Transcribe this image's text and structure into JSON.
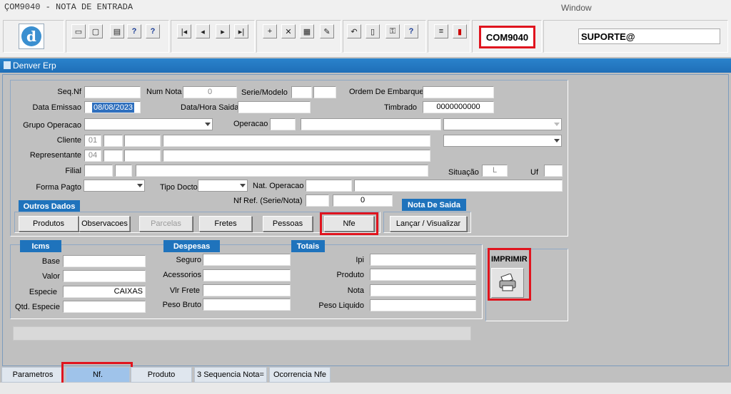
{
  "titlebar": {
    "title": "ÇOM9040 - NOTA DE ENTRADA",
    "menu": "Window"
  },
  "toolbar": {
    "form_code": "COM9040",
    "user": "SUPORTE@",
    "logo_letter": "d",
    "buttons": [
      {
        "name": "save-icon",
        "glyph": "▭"
      },
      {
        "name": "window-icon",
        "glyph": "▢"
      },
      {
        "name": "print-icon",
        "glyph": "▤"
      },
      {
        "name": "query-icon",
        "glyph": "?"
      },
      {
        "name": "execute-query-icon",
        "glyph": "?"
      },
      {
        "name": "first-record-icon",
        "glyph": "|◂"
      },
      {
        "name": "previous-record-icon",
        "glyph": "◂"
      },
      {
        "name": "next-record-icon",
        "glyph": "▸"
      },
      {
        "name": "last-record-icon",
        "glyph": "▸|"
      },
      {
        "name": "add-record-icon",
        "glyph": "+"
      },
      {
        "name": "delete-record-icon",
        "glyph": "✕"
      },
      {
        "name": "list-values-icon",
        "glyph": "▦"
      },
      {
        "name": "edit-icon",
        "glyph": "✎"
      },
      {
        "name": "undo-icon",
        "glyph": "↶"
      },
      {
        "name": "clipboard-icon",
        "glyph": "▯"
      },
      {
        "name": "keys-icon",
        "glyph": "⚿"
      },
      {
        "name": "help-icon",
        "glyph": "?"
      },
      {
        "name": "menu-icon",
        "glyph": "≡"
      },
      {
        "name": "exit-icon",
        "glyph": "▮"
      }
    ]
  },
  "window": {
    "title": "Denver Erp"
  },
  "form": {
    "seq_nf_label": "Seq.Nf",
    "num_nota_label": "Num Nota",
    "num_nota_value": "0",
    "serie_modelo_label": "Serie/Modelo",
    "ordem_embarque_label": "Ordem De Embarque",
    "data_emissao_label": "Data Emissao",
    "data_emissao_value": "08/08/2023",
    "data_hora_saida_label": "Data/Hora Saida",
    "timbrado_label": "Timbrado",
    "timbrado_value": "0000000000",
    "grupo_operacao_label": "Grupo Operacao",
    "operacao_label": "Operacao",
    "cliente_label": "Cliente",
    "cliente_code": "01",
    "representante_label": "Representante",
    "representante_code": "04",
    "filial_label": "Filial",
    "situacao_label": "Situação",
    "situacao_value": "L",
    "uf_label": "Uf",
    "forma_pagto_label": "Forma Pagto",
    "tipo_docto_label": "Tipo Docto",
    "nat_operacao_label": "Nat. Operacao",
    "nf_ref_label": "Nf Ref. (Serie/Nota)",
    "nf_ref_value": "0"
  },
  "outros_dados": {
    "tab": "Outros Dados",
    "buttons": [
      "Produtos",
      "Observacoes",
      "Parcelas",
      "Fretes",
      "Pessoas",
      "Nfe"
    ]
  },
  "nota_saida": {
    "tab": "Nota De Saida",
    "button": "Lançar / Visualizar"
  },
  "icms": {
    "tab": "Icms",
    "base": "Base",
    "valor": "Valor",
    "especie": "Especie",
    "especie_value": "CAIXAS",
    "qtd_especie": "Qtd. Especie"
  },
  "despesas": {
    "tab": "Despesas",
    "seguro": "Seguro",
    "acessorios": "Acessorios",
    "vlr_frete": "Vlr Frete",
    "peso_bruto": "Peso Bruto"
  },
  "totais": {
    "tab": "Totais",
    "ipi": "Ipi",
    "produto": "Produto",
    "nota": "Nota",
    "peso_liquido": "Peso Liquido"
  },
  "imprimir": {
    "label": "IMPRIMIR"
  },
  "bottom_tabs": [
    {
      "label": "Parametros",
      "active": false
    },
    {
      "label": "Nf.",
      "active": true
    },
    {
      "label": "Produto",
      "active": false
    },
    {
      "label": "3 Sequencia Nota=",
      "active": false
    },
    {
      "label": "Ocorrencia Nfe",
      "active": false
    }
  ],
  "colors": {
    "accent": "#1f73bc",
    "highlight": "#e0141e"
  }
}
